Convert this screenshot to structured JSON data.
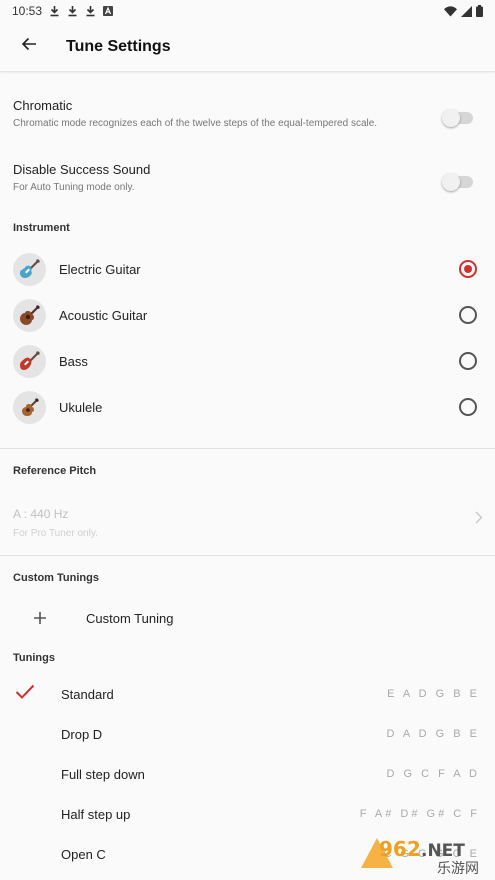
{
  "status_bar": {
    "time": "10:53",
    "left_icons": [
      "download-icon",
      "download-icon",
      "download-icon",
      "a-badge-icon"
    ],
    "right_icons": [
      "wifi-icon",
      "signal-icon",
      "battery-icon"
    ]
  },
  "header": {
    "title": "Tune Settings",
    "back_icon": "arrow-back-icon"
  },
  "settings": [
    {
      "title": "Chromatic",
      "subtitle": "Chromatic mode recognizes each of the twelve steps of the equal-tempered scale.",
      "enabled": false
    },
    {
      "title": "Disable Success Sound",
      "subtitle": "For Auto Tuning mode only.",
      "enabled": false
    }
  ],
  "instrument_section": {
    "title": "Instrument",
    "items": [
      {
        "label": "Electric Guitar",
        "icon": "electric-guitar-icon",
        "selected": true
      },
      {
        "label": "Acoustic Guitar",
        "icon": "acoustic-guitar-icon",
        "selected": false
      },
      {
        "label": "Bass",
        "icon": "bass-guitar-icon",
        "selected": false
      },
      {
        "label": "Ukulele",
        "icon": "ukulele-icon",
        "selected": false
      }
    ]
  },
  "reference_pitch": {
    "title": "Reference Pitch",
    "value": "A : 440 Hz",
    "subtitle": "For Pro Tuner only."
  },
  "custom_tunings": {
    "title": "Custom Tunings",
    "add_label": "Custom Tuning"
  },
  "tunings": {
    "title": "Tunings",
    "items": [
      {
        "name": "Standard",
        "notes": "E A D G B E",
        "selected": true
      },
      {
        "name": "Drop D",
        "notes": "D A D G B E",
        "selected": false
      },
      {
        "name": "Full step down",
        "notes": "D G C F A D",
        "selected": false
      },
      {
        "name": "Half step up",
        "notes": "F A# D# G# C F",
        "selected": false
      },
      {
        "name": "Open C",
        "notes": "C G C G C E",
        "selected": false
      }
    ]
  },
  "watermark": {
    "text": "962.NET",
    "subtext": "乐游网"
  },
  "colors": {
    "accent": "#d32f2f",
    "background": "#fafafa",
    "divider": "#e2e2e2"
  }
}
